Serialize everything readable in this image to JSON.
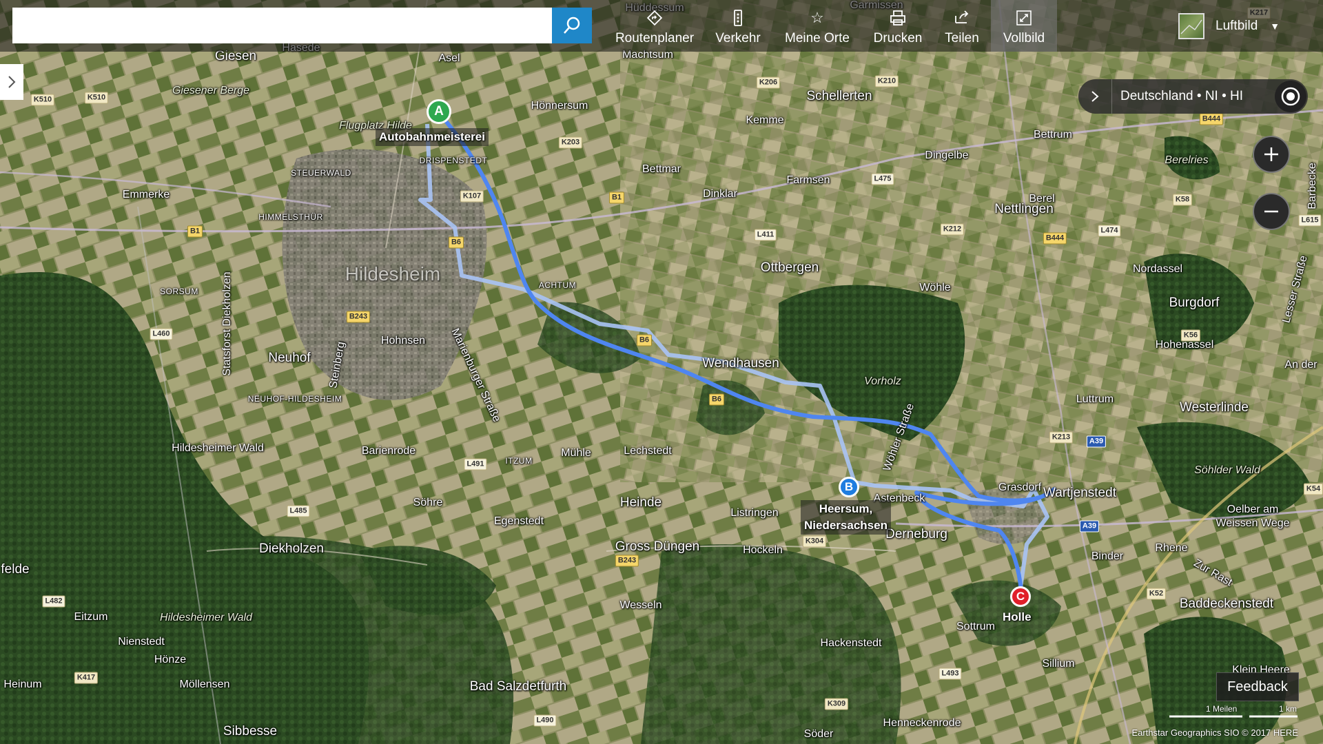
{
  "toolbar": {
    "search_value": "",
    "search_placeholder": "",
    "items": [
      {
        "label": "Routenplaner",
        "icon": "directions-icon"
      },
      {
        "label": "Verkehr",
        "icon": "traffic-icon"
      },
      {
        "label": "Meine Orte",
        "icon": "star-icon"
      },
      {
        "label": "Drucken",
        "icon": "print-icon"
      },
      {
        "label": "Teilen",
        "icon": "share-icon"
      },
      {
        "label": "Vollbild",
        "icon": "fullscreen-icon",
        "active": true
      }
    ],
    "map_style": "Luftbild"
  },
  "breadcrumb": "Deutschland • NI • HI",
  "waypoints": {
    "a": {
      "letter": "A",
      "label": "Autobahnmeisterei"
    },
    "b": {
      "letter": "B",
      "label_line1": "Heersum,",
      "label_line2": "Niedersachsen"
    },
    "c": {
      "letter": "C",
      "label": "Holle"
    }
  },
  "place_labels": {
    "giesen": "Giesen",
    "asel": "Asel",
    "hasede": "Hasede",
    "hoennersum": "Hönnersum",
    "schellerten": "Schellerten",
    "giesener_berge": "Giesener Berge",
    "flugplatz": "Flugplatz Hilde",
    "drispenstedt": "DRISPENSTEDT",
    "kemme": "Kemme",
    "bettrum": "Bettrum",
    "dingelbe": "Dingelbe",
    "steuerwald": "STEUERWALD",
    "emmerke": "Emmerke",
    "bettmar": "Bettmar",
    "farmsen": "Farmsen",
    "dinklar": "Dinklar",
    "berelries": "Berelries",
    "himmelsthuer": "HIMMELSTHÜR",
    "nettlingen": "Nettlingen",
    "berel": "Berel",
    "hildesheim": "Hildesheim",
    "achtum": "ACHTUM",
    "ottbergen": "Ottbergen",
    "sorsum": "SORSUM",
    "nordassel": "Nordassel",
    "woehle": "Wöhle",
    "burgdorf": "Burgdorf",
    "statsforst": "Statsforst Diekholzen",
    "hohenassel": "Hohenassel",
    "neuhof": "Neuhof",
    "steinberg": "Steinberg",
    "wendhausen": "Wendhausen",
    "vorholz": "Vorholz",
    "neuhof_hildesheim": "NEUHOF-HILDESHEIM",
    "luttrum": "Luttrum",
    "westerlinde": "Westerlinde",
    "hildesheimer_wald_n": "Hildesheimer Wald",
    "barienrode": "Barienrode",
    "lechstedt": "Lechstedt",
    "muehle": "Mühle",
    "itzum": "ITZUM",
    "soehlder_wald": "Söhlder Wald",
    "heinde": "Heinde",
    "listringen": "Listringen",
    "wartjenstedt": "Wartjenstedt",
    "grasdorf": "Grasdorf",
    "soehre": "Söhre",
    "egenstedt": "Egenstedt",
    "oelber": "Oelber am",
    "weissen_wege": "Weissen Wege",
    "diekholzen": "Diekholzen",
    "gross_duengen": "Gross Düngen",
    "hockeln": "Hockeln",
    "derneburg": "Derneburg",
    "binder": "Binder",
    "rhene": "Rhene",
    "felde": "felde",
    "baddeckenstedt": "Baddeckenstedt",
    "eitzum": "Eitzum",
    "wesseln": "Wesseln",
    "sottrum": "Sottrum",
    "hildesheimer_wald_s": "Hildesheimer Wald",
    "nienstedt": "Nienstedt",
    "hackenstedt": "Hackenstedt",
    "hoenze": "Hönze",
    "sillium": "Sillium",
    "moellensen": "Möllensen",
    "heinum": "Heinum",
    "bad_salzdetfurth": "Bad Salzdetfurth",
    "klein_heere": "Klein Heere",
    "henneckenrode": "Henneckenrode",
    "sibbesse": "Sibbesse",
    "soeder": "Söder",
    "hohnsen": "Hohnsen",
    "marienburger": "Marienburger Straße",
    "woehler_str": "Wöhler Straße",
    "lesser_str": "Lesser Straße",
    "zur_rast": "Zur Rast",
    "machtsum": "Machtsum",
    "huddessum": "Hüddessum",
    "garmissen": "Garmissen",
    "astenbeck": "Astenbeck",
    "holle_fragment": "Holle",
    "an_der": "An der",
    "barbecke": "Barbecke"
  },
  "road_shields": [
    "K510",
    "K510",
    "K206",
    "K210",
    "K203",
    "B444",
    "B444",
    "K107",
    "B1",
    "L475",
    "B1",
    "L411",
    "K212",
    "L474",
    "K58",
    "B6",
    "L460",
    "B243",
    "K56",
    "B6",
    "B6",
    "L491",
    "L485",
    "A39",
    "K213",
    "A39",
    "L482",
    "K304",
    "B243",
    "K52",
    "K417",
    "L493",
    "K309",
    "L490",
    "K217",
    "K54",
    "L615"
  ],
  "feedback_label": "Feedback",
  "scale": {
    "miles": "1 Meilen",
    "km": "1 km"
  },
  "copyright": "Earthstar Geographics SIO © 2017 HERE",
  "colors": {
    "route": "#4f86f0",
    "route_alt": "#a9c3f5",
    "pin_a": "#2fa84f",
    "pin_b": "#1f7de0",
    "pin_c": "#e0202a",
    "search_button": "#1f87c8"
  }
}
